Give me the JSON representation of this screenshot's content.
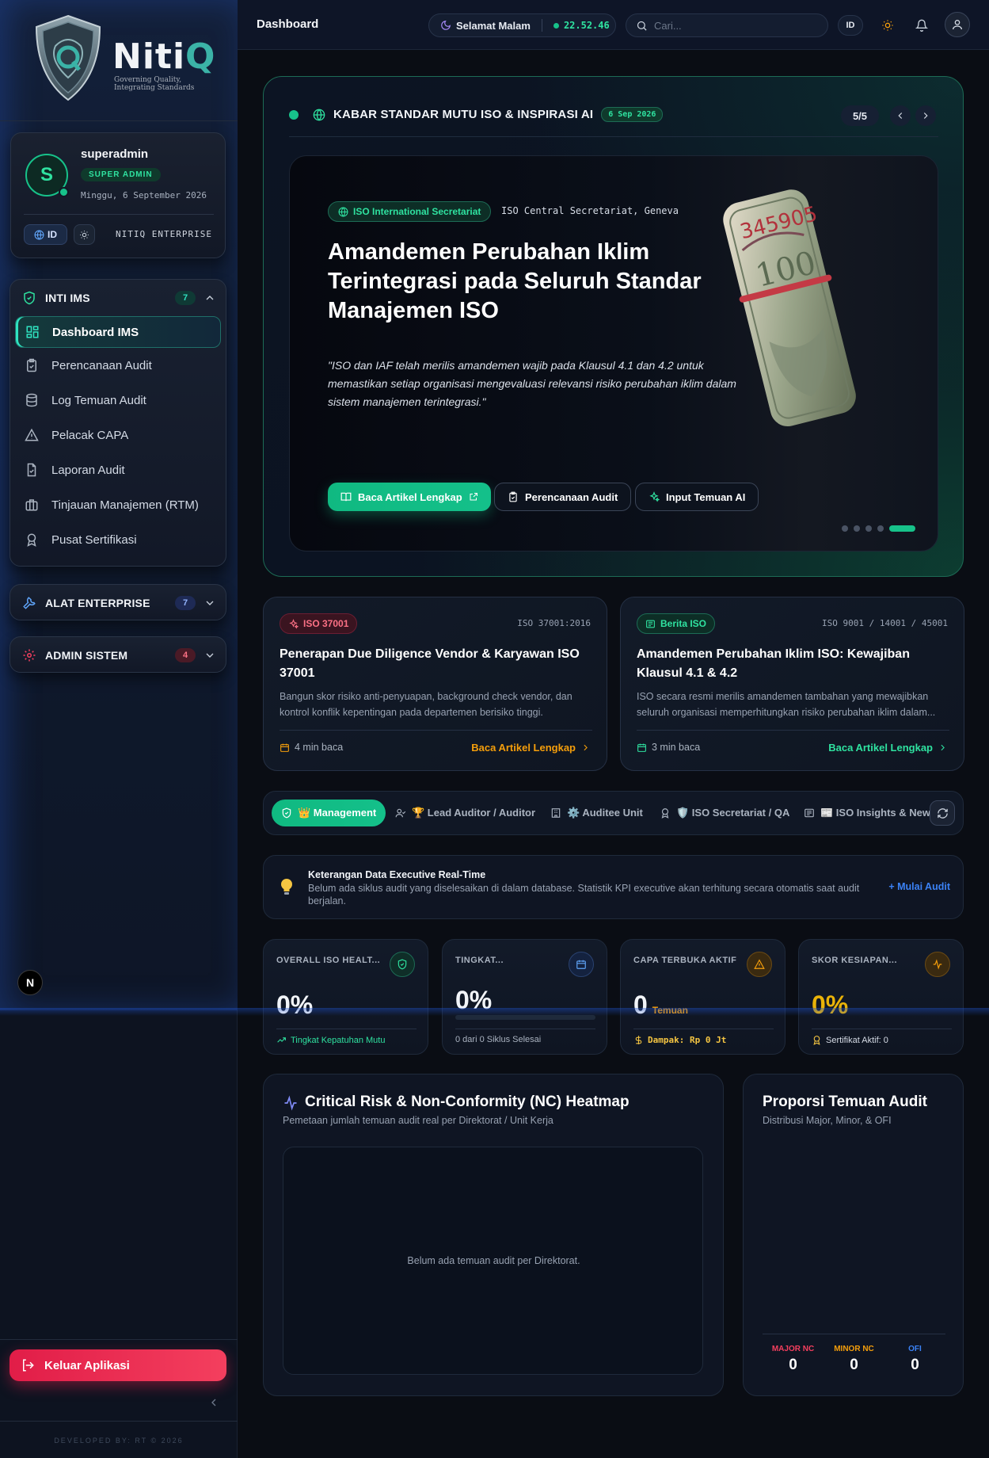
{
  "brand": {
    "name_main": "Niti",
    "name_accent": "Q",
    "tagline_line1": "Governing Quality,",
    "tagline_line2": "Integrating Standards"
  },
  "user": {
    "initial": "S",
    "name": "superadmin",
    "role": "SUPER ADMIN",
    "date": "Minggu, 6 September 2026",
    "lang": "ID",
    "edition": "NITIQ ENTERPRISE"
  },
  "sidebar": {
    "groups": [
      {
        "title": "INTI IMS",
        "count": "7",
        "items": [
          {
            "label": "Dashboard IMS",
            "icon": "dashboard-icon"
          },
          {
            "label": "Perencanaan Audit",
            "icon": "clipboard-check-icon"
          },
          {
            "label": "Log Temuan Audit",
            "icon": "database-icon"
          },
          {
            "label": "Pelacak CAPA",
            "icon": "warning-triangle-icon"
          },
          {
            "label": "Laporan Audit",
            "icon": "file-check-icon"
          },
          {
            "label": "Tinjauan Manajemen (RTM)",
            "icon": "briefcase-icon"
          },
          {
            "label": "Pusat Sertifikasi",
            "icon": "award-icon"
          }
        ]
      },
      {
        "title": "ALAT ENTERPRISE",
        "count": "7"
      },
      {
        "title": "ADMIN SISTEM",
        "count": "4"
      }
    ],
    "logout": "Keluar Aplikasi",
    "footer": "DEVELOPED BY: RT © 2026"
  },
  "header": {
    "title": "Dashboard",
    "greeting": "Selamat Malam",
    "time": "22.52.46",
    "search_placeholder": "Cari...",
    "lang": "ID"
  },
  "hero": {
    "section_title": "KABAR STANDAR MUTU ISO & INSPIRASI AI",
    "date": "6 Sep 2026",
    "counter": "5/5",
    "source_badge": "ISO International Secretariat",
    "source_text": "ISO Central Secretariat, Geneva",
    "title": "Amandemen Perubahan Iklim Terintegrasi pada Seluruh Standar Manajemen ISO",
    "quote": "\"ISO dan IAF telah merilis amandemen wajib pada Klausul 4.1 dan 4.2 untuk memastikan setiap organisasi mengevaluasi relevansi risiko perubahan iklim dalam sistem manajemen terintegrasi.\"",
    "btn_read": "Baca Artikel Lengkap",
    "btn_plan": "Perencanaan Audit",
    "btn_ai": "Input Temuan AI",
    "slides_total": 5,
    "active_slide": 5
  },
  "news": [
    {
      "tag": "ISO 37001",
      "standard": "ISO 37001:2016",
      "title": "Penerapan Due Diligence Vendor & Karyawan ISO 37001",
      "desc": "Bangun skor risiko anti-penyuapan, background check vendor, dan kontrol konflik kepentingan pada departemen berisiko tinggi.",
      "read_time": "4 min baca",
      "link": "Baca Artikel Lengkap"
    },
    {
      "tag": "Berita ISO",
      "standard": "ISO 9001 / 14001 / 45001",
      "title": "Amandemen Perubahan Iklim ISO: Kewajiban Klausul 4.1 & 4.2",
      "desc": "ISO secara resmi merilis amandemen tambahan yang mewajibkan seluruh organisasi memperhitungkan risiko perubahan iklim dalam...",
      "read_time": "3 min baca",
      "link": "Baca Artikel Lengkap"
    }
  ],
  "role_tabs": [
    {
      "label": "👑 Management"
    },
    {
      "label": "🏆 Lead Auditor / Auditor"
    },
    {
      "label": "⚙️ Auditee Unit"
    },
    {
      "label": "🛡️ ISO Secretariat / QA"
    },
    {
      "label": "📰 ISO Insights & News"
    }
  ],
  "info": {
    "title": "Keterangan Data Executive Real-Time",
    "desc": "Belum ada siklus audit yang diselesaikan di dalam database. Statistik KPI executive akan terhitung secara otomatis saat audit berjalan.",
    "cta": "+ Mulai Audit"
  },
  "kpis": [
    {
      "label": "OVERALL ISO HEALT...",
      "value": "0%",
      "foot": "Tingkat Kepatuhan Mutu"
    },
    {
      "label": "TINGKAT...",
      "value": "0%",
      "foot": "0 dari 0 Siklus Selesai",
      "progress": 0
    },
    {
      "label": "CAPA TERBUKA AKTIF",
      "value": "0",
      "unit": "Temuan",
      "foot": "Dampak: Rp 0 Jt"
    },
    {
      "label": "SKOR KESIAPAN...",
      "value": "0%",
      "foot": "Sertifikat Aktif: 0"
    }
  ],
  "heatmap": {
    "title": "Critical Risk & Non-Conformity (NC) Heatmap",
    "subtitle": "Pemetaan jumlah temuan audit real per Direktorat / Unit Kerja",
    "empty": "Belum ada temuan audit per Direktorat."
  },
  "proportion": {
    "title": "Proporsi Temuan Audit",
    "subtitle": "Distribusi Major, Minor, & OFI",
    "stats": [
      {
        "label": "MAJOR NC",
        "value": "0",
        "color": "#f43f5e"
      },
      {
        "label": "MINOR NC",
        "value": "0",
        "color": "#f59e0b"
      },
      {
        "label": "OFI",
        "value": "0",
        "color": "#3b82f6"
      }
    ]
  },
  "colors": {
    "accent": "#10b981",
    "danger": "#e11d48",
    "warning": "#f59e0b",
    "info": "#3b82f6"
  }
}
